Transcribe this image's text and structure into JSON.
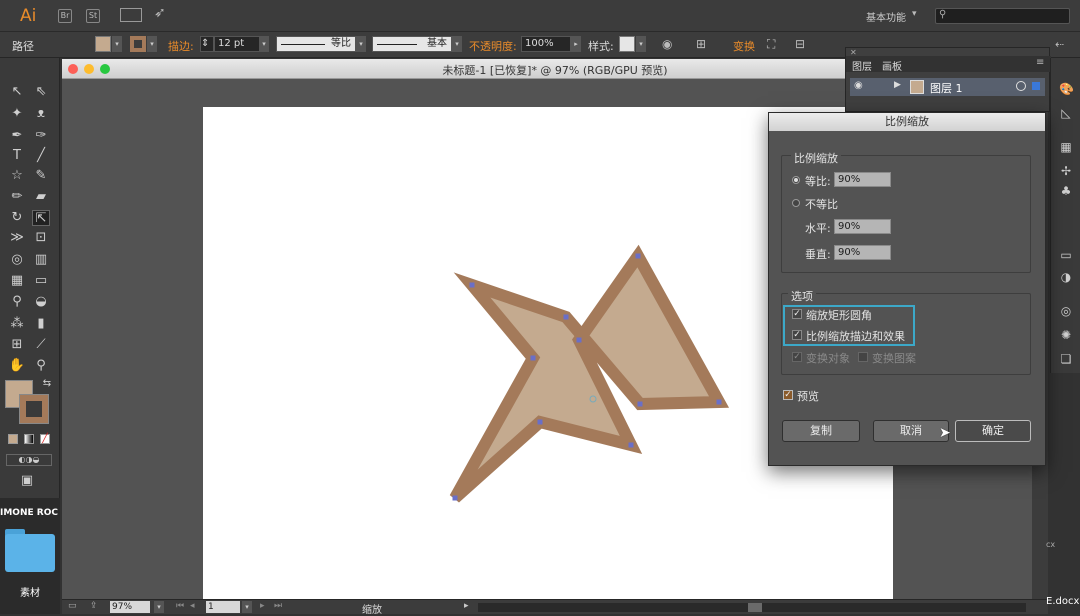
{
  "app": {
    "logo": "Ai",
    "br_icon": "Br",
    "st_icon": "St",
    "workspace": "基本功能",
    "search_placeholder": ""
  },
  "control": {
    "path_label": "路径",
    "stroke_label": "描边:",
    "stroke_value": "12 pt",
    "profile_label": "等比",
    "brush_label": "基本",
    "opacity_label": "不透明度:",
    "opacity_value": "100%",
    "style_label": "样式:",
    "transform_label": "变换",
    "fill_color": "#c4aa8f",
    "stroke_color": "#a47a5a"
  },
  "document": {
    "title": "未标题-1 [已恢复]* @ 97% (RGB/GPU 预览)"
  },
  "status": {
    "zoom": "97%",
    "artboard": "1",
    "tool_name": "缩放"
  },
  "layers_panel": {
    "tab_layers": "图层",
    "tab_artboards": "画板",
    "layer_name": "图层 1"
  },
  "dialog": {
    "title": "比例缩放",
    "scale_group": "比例缩放",
    "uniform_label": "等比:",
    "uniform_value": "90%",
    "non_uniform_label": "不等比",
    "horizontal_label": "水平:",
    "horizontal_value": "90%",
    "vertical_label": "垂直:",
    "vertical_value": "90%",
    "options_group": "选项",
    "scale_corners": "缩放矩形圆角",
    "scale_strokes": "比例缩放描边和效果",
    "transform_objects": "变换对象",
    "transform_patterns": "变换图案",
    "preview": "预览",
    "copy_button": "复制",
    "cancel_button": "取消",
    "ok_button": "确定"
  },
  "desktop": {
    "name_partial": "IMONE ROC",
    "folder_label": "素材",
    "file_hint": "E.docx"
  },
  "star": {
    "fill": "#c4aa8f",
    "stroke": "#a47a5a"
  }
}
